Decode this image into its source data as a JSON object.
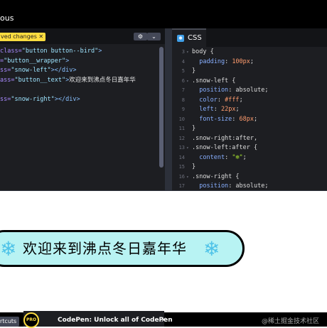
{
  "topbar": {
    "title": "ous"
  },
  "html_pane": {
    "unsaved_badge": "ved changes ✕",
    "gear_icon": "⚙",
    "chevron_icon": "⌄",
    "lines": [
      [
        {
          "c": "attr",
          "t": "class="
        },
        {
          "c": "str",
          "t": "\"button button--bird\""
        },
        {
          "c": "tag",
          "t": ">"
        }
      ],
      [
        {
          "c": "attr",
          "t": "="
        },
        {
          "c": "str",
          "t": "\"button__wrapper\""
        },
        {
          "c": "tag",
          "t": ">"
        }
      ],
      [
        {
          "c": "attr",
          "t": "ss="
        },
        {
          "c": "str",
          "t": "\"snow-left\""
        },
        {
          "c": "tag",
          "t": "></div>"
        }
      ],
      [
        {
          "c": "attr",
          "t": "ass="
        },
        {
          "c": "str",
          "t": "\"button__text\""
        },
        {
          "c": "tag",
          "t": ">"
        },
        {
          "c": "txt",
          "t": "欢迎来到沸点冬日嘉年华"
        }
      ],
      [
        {
          "c": "txt",
          "t": ""
        }
      ],
      [
        {
          "c": "attr",
          "t": "ss="
        },
        {
          "c": "str",
          "t": "\"snow-right\""
        },
        {
          "c": "tag",
          "t": "></div>"
        }
      ]
    ]
  },
  "css_pane": {
    "tab_label": "CSS",
    "tab_icon": "✱",
    "rows": [
      {
        "n": "3",
        "f": "▾",
        "parts": [
          {
            "c": "sel",
            "t": "body {"
          }
        ]
      },
      {
        "n": "4",
        "f": "",
        "parts": [
          {
            "c": "prop",
            "t": "  padding"
          },
          {
            "c": "sel",
            "t": ": "
          },
          {
            "c": "val",
            "t": "100px"
          },
          {
            "c": "sel",
            "t": ";"
          }
        ]
      },
      {
        "n": "5",
        "f": "",
        "parts": [
          {
            "c": "sel",
            "t": "}"
          }
        ]
      },
      {
        "n": "6",
        "f": "▾",
        "parts": [
          {
            "c": "sel",
            "t": ".snow-left {"
          }
        ]
      },
      {
        "n": "7",
        "f": "",
        "parts": [
          {
            "c": "prop",
            "t": "  position"
          },
          {
            "c": "sel",
            "t": ": absolute;"
          }
        ]
      },
      {
        "n": "8",
        "f": "",
        "parts": [
          {
            "c": "prop",
            "t": "  color"
          },
          {
            "c": "sel",
            "t": ": "
          },
          {
            "c": "val",
            "t": "#fff"
          },
          {
            "c": "sel",
            "t": ";"
          }
        ]
      },
      {
        "n": "9",
        "f": "",
        "parts": [
          {
            "c": "prop",
            "t": "  left"
          },
          {
            "c": "sel",
            "t": ": "
          },
          {
            "c": "val",
            "t": "22px"
          },
          {
            "c": "sel",
            "t": ";"
          }
        ]
      },
      {
        "n": "10",
        "f": "",
        "parts": [
          {
            "c": "prop",
            "t": "  font-size"
          },
          {
            "c": "sel",
            "t": ": "
          },
          {
            "c": "val",
            "t": "68px"
          },
          {
            "c": "sel",
            "t": ";"
          }
        ]
      },
      {
        "n": "11",
        "f": "",
        "parts": [
          {
            "c": "sel",
            "t": "}"
          }
        ]
      },
      {
        "n": "12",
        "f": "",
        "parts": [
          {
            "c": "sel",
            "t": ".snow-right:after,"
          }
        ]
      },
      {
        "n": "13",
        "f": "▾",
        "parts": [
          {
            "c": "sel",
            "t": ".snow-left:after {"
          }
        ]
      },
      {
        "n": "14",
        "f": "",
        "parts": [
          {
            "c": "prop",
            "t": "  content"
          },
          {
            "c": "sel",
            "t": ": "
          },
          {
            "c": "strv",
            "t": "\"❄\""
          },
          {
            "c": "sel",
            "t": ";"
          }
        ]
      },
      {
        "n": "15",
        "f": "",
        "parts": [
          {
            "c": "sel",
            "t": "}"
          }
        ]
      },
      {
        "n": "16",
        "f": "▾",
        "parts": [
          {
            "c": "sel",
            "t": ".snow-right {"
          }
        ]
      },
      {
        "n": "17",
        "f": "",
        "parts": [
          {
            "c": "prop",
            "t": "  position"
          },
          {
            "c": "sel",
            "t": ": absolute;"
          }
        ]
      }
    ]
  },
  "preview": {
    "flake_left": "❄",
    "text": "欢迎来到沸点冬日嘉年华",
    "flake_right": "❄",
    "button_bg": "#b8f3f3",
    "flake_color": "#4fc3e8"
  },
  "bottombar": {
    "shortcuts_label": "rtcuts",
    "pro_badge": "PRO",
    "promo_text": "CodePen: Unlock all of CodePen",
    "promo_close": "✕"
  },
  "watermark": "@稀土掘金技术社区"
}
